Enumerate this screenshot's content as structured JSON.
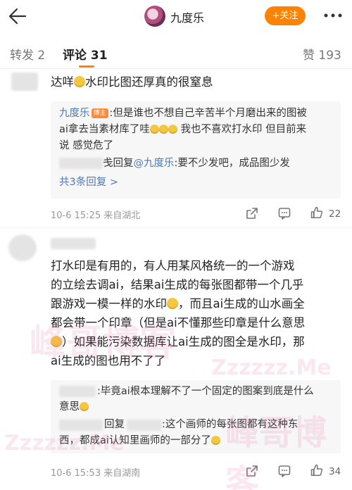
{
  "header": {
    "author_name": "九度乐",
    "follow_label": "+关注"
  },
  "tabs": {
    "repost": "转发 2",
    "comments": "评论 31",
    "likes": "赞 193"
  },
  "comment1": {
    "text_before_emoji": "达咩",
    "text_after_emoji": "水印比图还厚真的很窒息",
    "reply1_name": "九度乐",
    "reply1_badge": "博主",
    "reply1_text_a": ":但是谁也不想自己辛苦半个月磨出来的图被",
    "reply1_text_b": "ai拿去当素材库了哇",
    "reply1_text_c": "我也不喜欢打水印 但目前来",
    "reply1_text_d": "说 感觉危了",
    "reply2_tail": "戋回复",
    "reply2_mention": "@九度乐",
    "reply2_text": ":要不少发吧，成品图少发",
    "more_replies": "共3条回复 >",
    "meta": "10-6 15:25  来自湖北",
    "like_count": "22"
  },
  "comment2": {
    "line1": "打水印是有用的，有人用某风格统一的一个游戏",
    "line2": "的立绘去调ai，结果ai生成的每张图都带一个几乎",
    "line3": "跟游戏一模一样的水印",
    "line3b": "，而且ai生成的山水画全",
    "line4": "都会带一个印章（但是ai不懂那些印章是什么意思",
    "line5": "）如果能污染数据库让ai生成的图全是水印，那",
    "line6": "ai生成的图也用不了了",
    "reply1_text_a": ":毕竟ai根本理解不了一个固定的图案到底是什么",
    "reply1_text_b": "意思",
    "reply2_head": "回复",
    "reply2_text_a": ":这个画师的每张图都有这种东",
    "reply2_text_b": "西，都成ai认知里画师的一部分了",
    "meta": "10-6 15:53  来自湖南",
    "like_count": "34"
  },
  "watermark": {
    "cn": "峰哥博客",
    "en": "Zzzzzz.Me"
  },
  "colors": {
    "accent": "#ff8200",
    "link": "#4c7ab8",
    "meta": "#999999"
  },
  "icons": [
    "back-arrow-icon",
    "more-dots-icon",
    "share-icon",
    "comment-icon",
    "like-icon",
    "emoji-icon"
  ]
}
